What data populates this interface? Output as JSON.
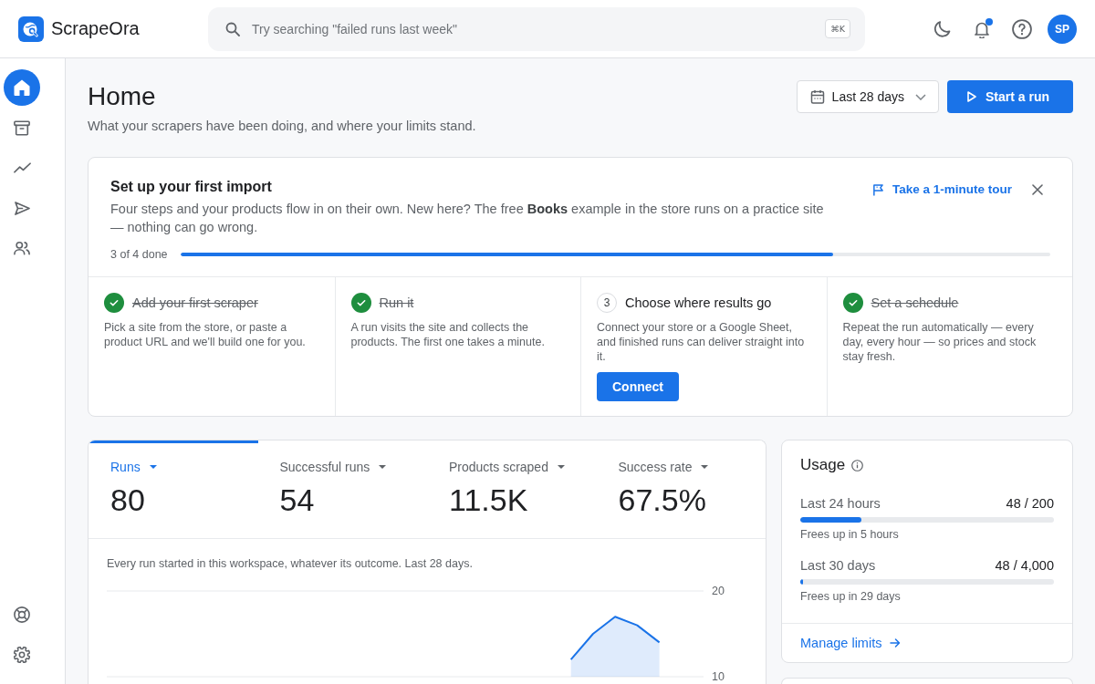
{
  "topbar": {
    "brand": "ScrapeOra",
    "search": {
      "placeholder": "Try searching \"failed runs last week\"",
      "shortcut": "⌘K"
    },
    "notifications": {
      "unread": true
    },
    "avatar": "SP"
  },
  "sidebar": {
    "items": [
      {
        "selected": true
      },
      {
        "selected": false
      },
      {
        "selected": false
      },
      {
        "selected": false
      },
      {
        "selected": false
      }
    ]
  },
  "header": {
    "title": "Home",
    "subtitle": "What your scrapers have been doing, and where your limits stand.",
    "date_range": {
      "value": "Last 28 days"
    },
    "primary_action": "Start a run"
  },
  "setup": {
    "title": "Set up your first import",
    "description": "Four steps and your products flow in on their own. New here? The free **Books** example in the store runs on a practice site — nothing can go wrong.",
    "tour_link": "Take a 1-minute tour",
    "progress": {
      "label": "3 of 4 done",
      "level": 0.75
    },
    "steps": [
      {
        "title": "Add your first scraper",
        "description": "Pick a site from the store, or paste a product URL and we'll build one for you.",
        "done": true
      },
      {
        "title": "Run it",
        "description": "A run visits the site and collects the products. The first one takes a minute.",
        "done": true
      },
      {
        "number": "3",
        "title": "Choose where results go",
        "description": "Connect your store or a Google Sheet, and finished runs can deliver straight into it.",
        "done": false,
        "action": "Connect"
      },
      {
        "title": "Set a schedule",
        "description": "Repeat the run automatically — every day, every hour — so prices and stock stay fresh.",
        "done": true
      }
    ]
  },
  "metrics": {
    "tabs": [
      {
        "label": "Runs",
        "value": "80",
        "selected": true
      },
      {
        "label": "Successful runs",
        "value": "54",
        "selected": false
      },
      {
        "label": "Products scraped",
        "value": "11.5K",
        "selected": false
      },
      {
        "label": "Success rate",
        "value": "67.5%",
        "selected": false
      }
    ],
    "caption": "Every run started in this workspace, whatever its outcome. Last 28 days.",
    "chart_data": {
      "type": "area",
      "ylim": [
        10,
        20
      ],
      "yticks": [
        10,
        20
      ],
      "series": [
        {
          "color": "#1a73e8",
          "values": [
            null,
            null,
            null,
            null,
            null,
            null,
            null,
            null,
            null,
            null,
            null,
            null,
            null,
            null,
            null,
            null,
            null,
            null,
            null,
            null,
            null,
            12,
            15,
            17,
            16,
            14,
            null,
            null
          ]
        }
      ]
    }
  },
  "usage": {
    "title": "Usage",
    "rows": [
      {
        "label": "Last 24 hours",
        "reading": "48 / 200",
        "level": 0.24,
        "note": "Frees up in 5 hours"
      },
      {
        "label": "Last 30 days",
        "reading": "48 / 4,000",
        "level": 0.012,
        "note": "Frees up in 29 days"
      }
    ],
    "link": "Manage limits"
  }
}
